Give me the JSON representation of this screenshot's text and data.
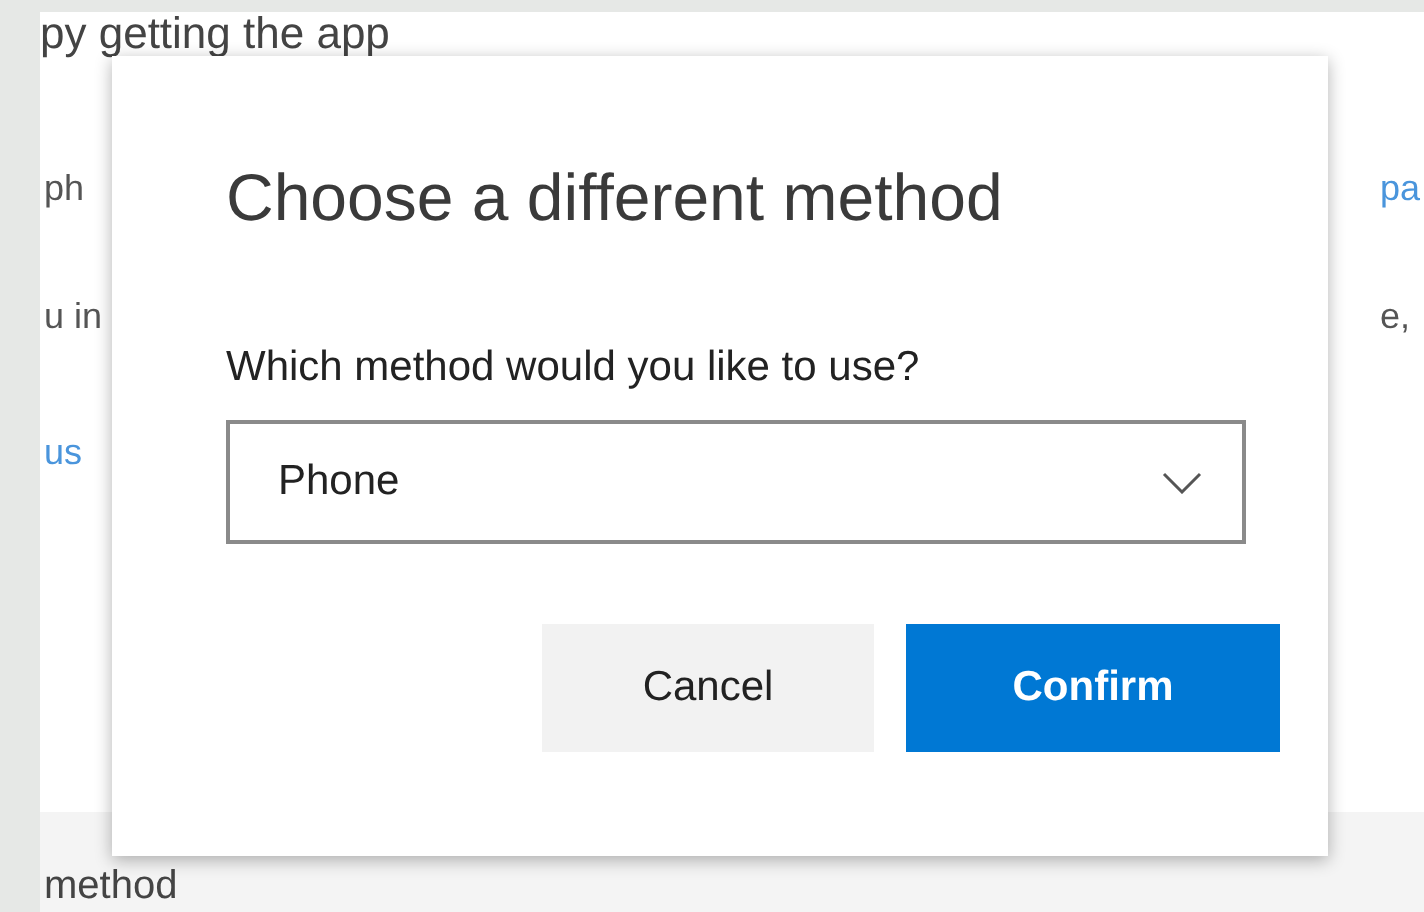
{
  "background": {
    "heading": "py getting the app",
    "left_lines": [
      {
        "text": "ph",
        "kind": "text"
      },
      {
        "text": "u in",
        "kind": "text"
      },
      {
        "text": "us",
        "kind": "link"
      }
    ],
    "right_lines": [
      {
        "text": "pa",
        "kind": "link"
      },
      {
        "text": "e,",
        "kind": "text"
      }
    ],
    "footer_text": "method"
  },
  "dialog": {
    "title": "Choose a different method",
    "field_label": "Which method would you like to use?",
    "method_select": {
      "value": "Phone"
    },
    "buttons": [
      {
        "label": "Cancel",
        "kind": "secondary"
      },
      {
        "label": "Confirm",
        "kind": "primary"
      }
    ]
  }
}
